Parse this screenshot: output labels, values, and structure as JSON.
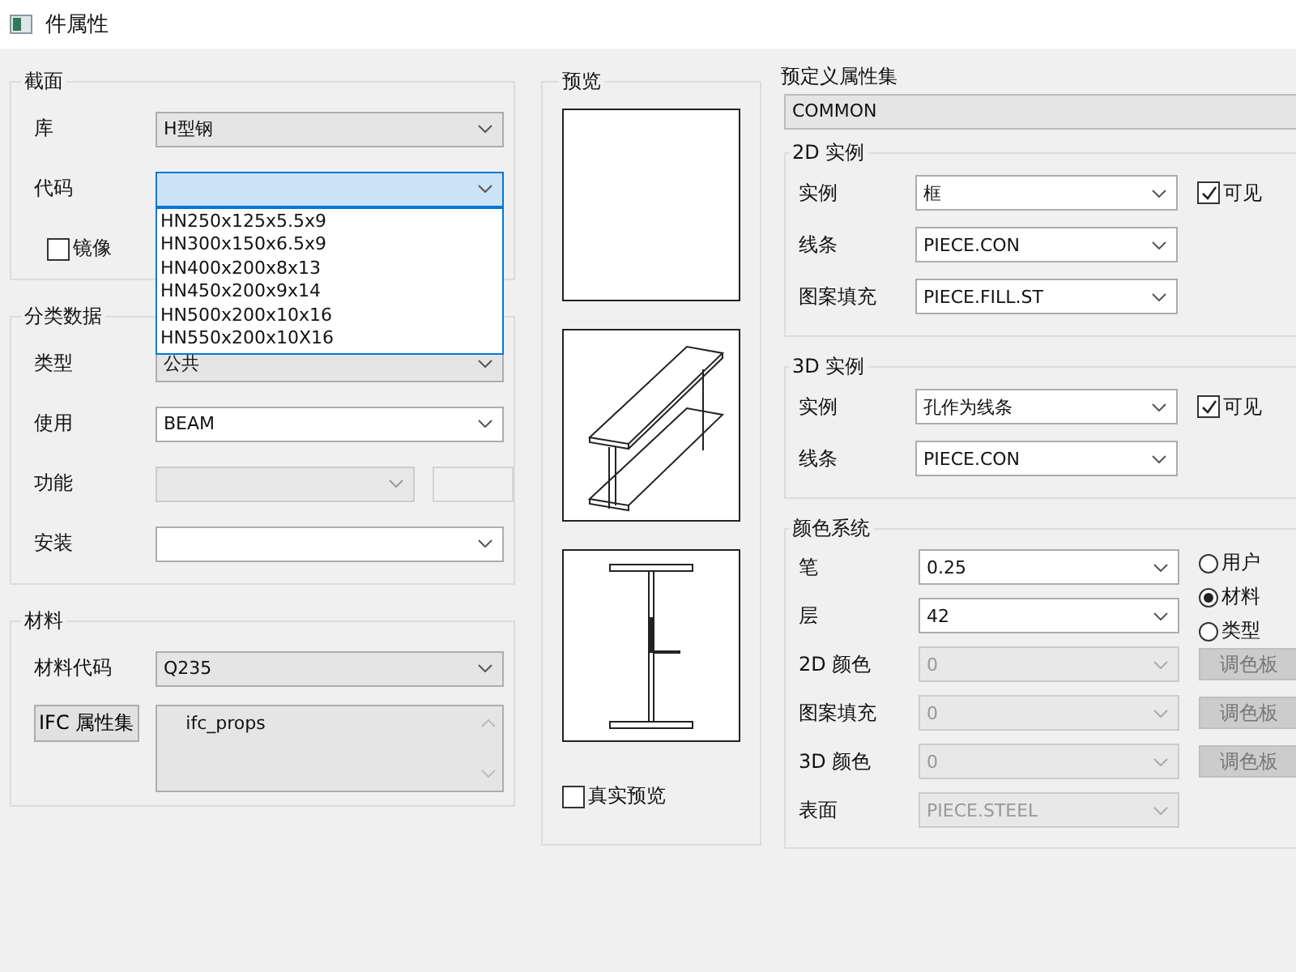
{
  "window": {
    "title": "件属性"
  },
  "section": {
    "title": "截面",
    "fields": [
      {
        "label": "库",
        "kind": "list",
        "value": "H型钢",
        "disabled": false,
        "expanded": false
      },
      {
        "label": "代码",
        "kind": "list",
        "disabled": false,
        "expanded": true,
        "options": [
          "HN250x125x5.5x9",
          "HN300x150x6.5x9",
          "HN400x200x8x13",
          "HN450x200x9x14",
          "HN500x200x10x16",
          "HN550x200x10X16"
        ]
      }
    ],
    "mirror": {
      "label": "镜像",
      "checked": false
    }
  },
  "classification": {
    "title": "分类数据",
    "fields": [
      {
        "label": "类型",
        "kind": "list",
        "value": "公共",
        "disabled": false,
        "side_box": false
      },
      {
        "label": "使用",
        "kind": "edit",
        "value": "BEAM",
        "disabled": false,
        "side_box": false
      },
      {
        "label": "功能",
        "kind": "list",
        "disabled": true,
        "side_box": true
      },
      {
        "label": "安装",
        "kind": "edit",
        "disabled": false,
        "side_box": false
      }
    ]
  },
  "material": {
    "title": "材料",
    "code": {
      "label": "材料代码",
      "kind": "list",
      "value": "Q235"
    },
    "ifc_button": "IFC 属性集",
    "ifc_text": "ifc_props"
  },
  "preview": {
    "title": "预览",
    "panes": [
      {
        "kind": "blank"
      },
      {
        "kind": "isometric"
      },
      {
        "kind": "section"
      }
    ],
    "real_preview": {
      "label": "真实预览",
      "checked": false
    }
  },
  "predefined": {
    "label": "预定义属性集",
    "value": "COMMON"
  },
  "groups": [
    {
      "title": "2D 实例",
      "rows": [
        {
          "label": "实例",
          "value": "框",
          "visible": {
            "label": "可见",
            "checked": true
          }
        },
        {
          "label": "线条",
          "value": "PIECE.CON"
        },
        {
          "label": "图案填充",
          "value": "PIECE.FILL.ST"
        }
      ]
    },
    {
      "title": "3D 实例",
      "rows": [
        {
          "label": "实例",
          "value": "孔作为线条",
          "visible": {
            "label": "可见",
            "checked": true
          }
        },
        {
          "label": "线条",
          "value": "PIECE.CON"
        }
      ]
    }
  ],
  "color_system": {
    "title": "颜色系统",
    "rows": [
      {
        "label": "笔",
        "value": "0.25",
        "disabled": false
      },
      {
        "label": "层",
        "value": "42",
        "disabled": false
      },
      {
        "label": "2D 颜色",
        "value": "0",
        "disabled": true,
        "button": {
          "label": "调色板",
          "disabled": true
        }
      },
      {
        "label": "图案填充",
        "value": "0",
        "disabled": true,
        "button": {
          "label": "调色板",
          "disabled": true
        }
      },
      {
        "label": "3D 颜色",
        "value": "0",
        "disabled": true,
        "button": {
          "label": "调色板",
          "disabled": true
        }
      },
      {
        "label": "表面",
        "value": "PIECE.STEEL",
        "disabled": true
      }
    ],
    "radios": [
      {
        "label": "用户",
        "selected": false
      },
      {
        "label": "材料",
        "selected": true
      },
      {
        "label": "类型",
        "selected": false
      }
    ]
  }
}
